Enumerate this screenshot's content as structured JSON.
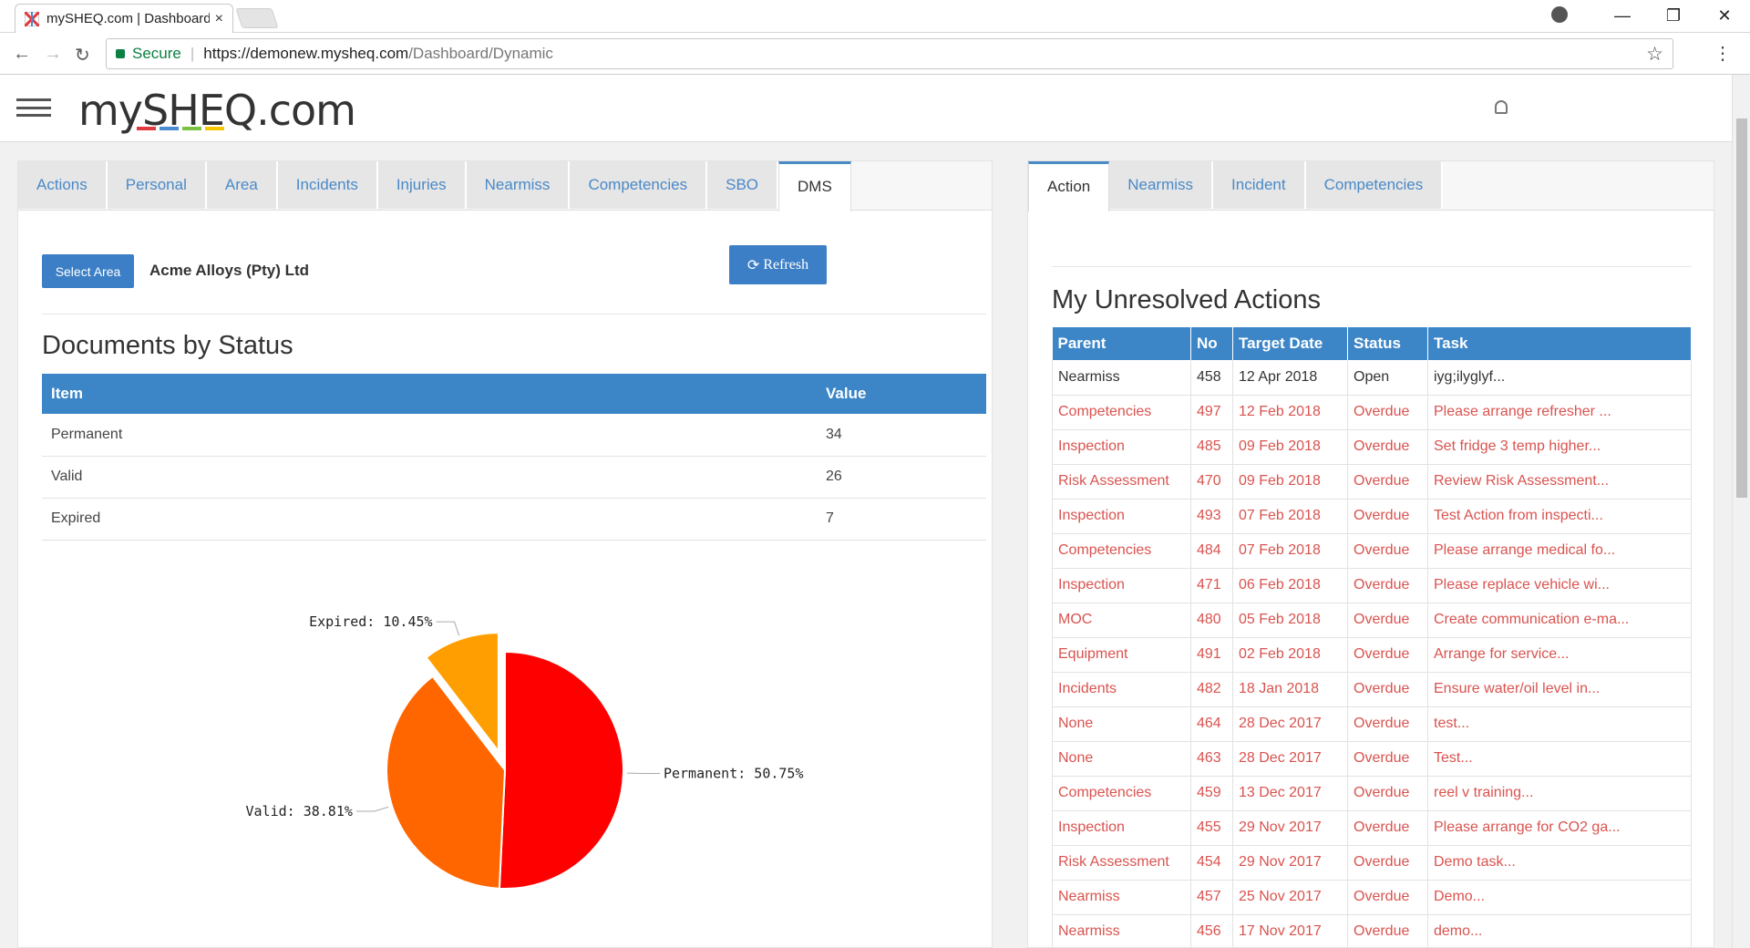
{
  "browser": {
    "tab_title": "mySHEQ.com | Dashboard",
    "close_glyph": "×",
    "secure_label": "Secure",
    "url_host": "https://demonew.mysheq.com",
    "url_path": "/Dashboard/Dynamic",
    "nav": {
      "back": "←",
      "forward": "→",
      "reload": "↻",
      "star": "☆",
      "menu": "⋮"
    },
    "window": {
      "minimize": "—",
      "restore": "❐",
      "close": "✕"
    }
  },
  "app": {
    "logo": "mySHEQ.com",
    "logo_bar_colors": [
      "#e03a3e",
      "#4a8bd1",
      "#7cc242",
      "#f5c700"
    ],
    "accent": "#3c86c8"
  },
  "left_panel": {
    "tabs": [
      "Actions",
      "Personal",
      "Area",
      "Incidents",
      "Injuries",
      "Nearmiss",
      "Competencies",
      "SBO",
      "DMS"
    ],
    "active_tab": "DMS",
    "select_area_label": "Select Area",
    "area_name": "Acme Alloys (Pty) Ltd",
    "refresh_label": "Refresh",
    "documents_title": "Documents by Status",
    "doc_table": {
      "headers": [
        "Item",
        "Value"
      ],
      "rows": [
        [
          "Permanent",
          "34"
        ],
        [
          "Valid",
          "26"
        ],
        [
          "Expired",
          "7"
        ]
      ]
    }
  },
  "chart_data": {
    "type": "pie",
    "categories": [
      "Permanent",
      "Valid",
      "Expired"
    ],
    "values": [
      34,
      26,
      7
    ],
    "labels": [
      "Permanent: 50.75%",
      "Valid: 38.81%",
      "Expired: 10.45%"
    ],
    "colors": [
      "#ff0000",
      "#ff6600",
      "#ff9e01"
    ]
  },
  "right_panel": {
    "tabs": [
      "Action",
      "Nearmiss",
      "Incident",
      "Competencies"
    ],
    "active_tab": "Action",
    "title": "My Unresolved Actions",
    "table": {
      "headers": [
        "Parent",
        "No",
        "Target Date",
        "Status",
        "Task"
      ],
      "rows": [
        [
          "Nearmiss",
          "458",
          "12 Apr 2018",
          "Open",
          "iyg;ilyglyf..."
        ],
        [
          "Competencies",
          "497",
          "12 Feb 2018",
          "Overdue",
          "Please arrange refresher ..."
        ],
        [
          "Inspection",
          "485",
          "09 Feb 2018",
          "Overdue",
          "Set fridge 3 temp higher..."
        ],
        [
          "Risk Assessment",
          "470",
          "09 Feb 2018",
          "Overdue",
          "Review Risk Assessment..."
        ],
        [
          "Inspection",
          "493",
          "07 Feb 2018",
          "Overdue",
          "Test Action from inspecti..."
        ],
        [
          "Competencies",
          "484",
          "07 Feb 2018",
          "Overdue",
          "Please arrange medical fo..."
        ],
        [
          "Inspection",
          "471",
          "06 Feb 2018",
          "Overdue",
          "Please replace vehicle wi..."
        ],
        [
          "MOC",
          "480",
          "05 Feb 2018",
          "Overdue",
          "Create communication e-ma..."
        ],
        [
          "Equipment",
          "491",
          "02 Feb 2018",
          "Overdue",
          "Arrange for service..."
        ],
        [
          "Incidents",
          "482",
          "18 Jan 2018",
          "Overdue",
          "Ensure water/oil level in..."
        ],
        [
          "None",
          "464",
          "28 Dec 2017",
          "Overdue",
          "test..."
        ],
        [
          "None",
          "463",
          "28 Dec 2017",
          "Overdue",
          "Test..."
        ],
        [
          "Competencies",
          "459",
          "13 Dec 2017",
          "Overdue",
          "reel v training..."
        ],
        [
          "Inspection",
          "455",
          "29 Nov 2017",
          "Overdue",
          "Please arrange for CO2 ga..."
        ],
        [
          "Risk Assessment",
          "454",
          "29 Nov 2017",
          "Overdue",
          "Demo task..."
        ],
        [
          "Nearmiss",
          "457",
          "25 Nov 2017",
          "Overdue",
          "Demo..."
        ],
        [
          "Nearmiss",
          "456",
          "17 Nov 2017",
          "Overdue",
          "demo..."
        ]
      ]
    }
  }
}
